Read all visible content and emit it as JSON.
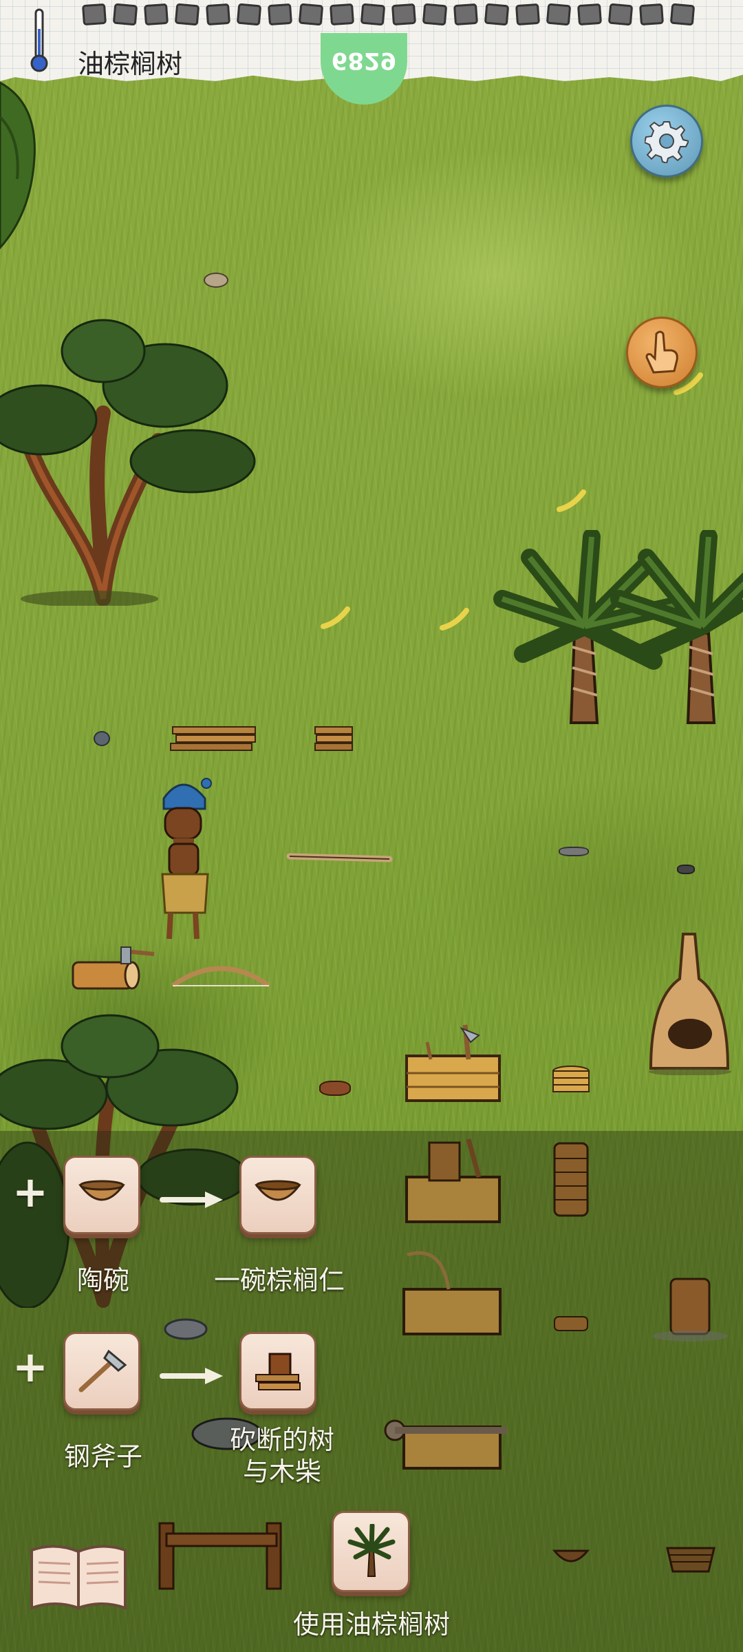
{
  "hud": {
    "object_name": "油棕榈树",
    "yum_counter": "6829",
    "food_pips": 20,
    "icons": [
      "thermometer-icon",
      "food-pip-icon",
      "settings-gear-icon",
      "hand-pointer-icon",
      "recipe-book-icon"
    ]
  },
  "hints": {
    "step1": {
      "ingredient": "陶碗",
      "result": "一碗棕榈仁",
      "ingredient_icon": "clay-bowl-icon",
      "result_icon": "clay-bowl-icon"
    },
    "step2": {
      "ingredient": "钢斧子",
      "result": "砍断的树\n与木柴",
      "ingredient_icon": "steel-axe-icon",
      "result_icon": "firewood-icon"
    },
    "use": {
      "label": "使用油棕榈树",
      "icon": "oil-palm-icon"
    }
  },
  "colors": {
    "grass": "#84a63a",
    "paper": "#f4f2ec",
    "tile": "#f0d8c8",
    "settings": "#6fa8c8",
    "hand": "#e09a4c",
    "yum": "#7fd88f"
  }
}
